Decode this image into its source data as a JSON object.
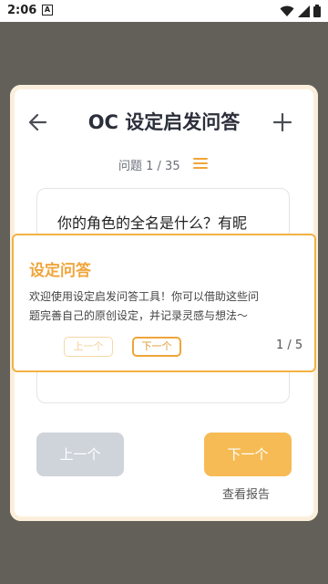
{
  "status_bar": {
    "time": "2:06",
    "notification_glyph": "A"
  },
  "header": {
    "title": "OC 设定启发问答",
    "counter": "问题 1 / 35"
  },
  "question": {
    "text": "你的角色的全名是什么？有昵"
  },
  "buttons": {
    "prev": "上一个",
    "next": "下一个",
    "report": "查看报告"
  },
  "tour": {
    "title": "设定问答",
    "line1": "欢迎使用设定启发问答工具！你可以借助这些问",
    "line2": "题完善自己的原创设定，并记录灵感与想法～",
    "prev": "上一个",
    "next": "下一个",
    "step": "1 / 5"
  },
  "colors": {
    "accent": "#f6bb55",
    "tour_border": "#f4b142",
    "disabled": "#cfd3da",
    "backdrop": "#626058"
  },
  "icons": {
    "back": "arrow-left-icon",
    "add": "plus-icon",
    "list": "list-icon",
    "wifi": "wifi-icon",
    "signal": "signal-icon",
    "battery": "battery-icon"
  }
}
